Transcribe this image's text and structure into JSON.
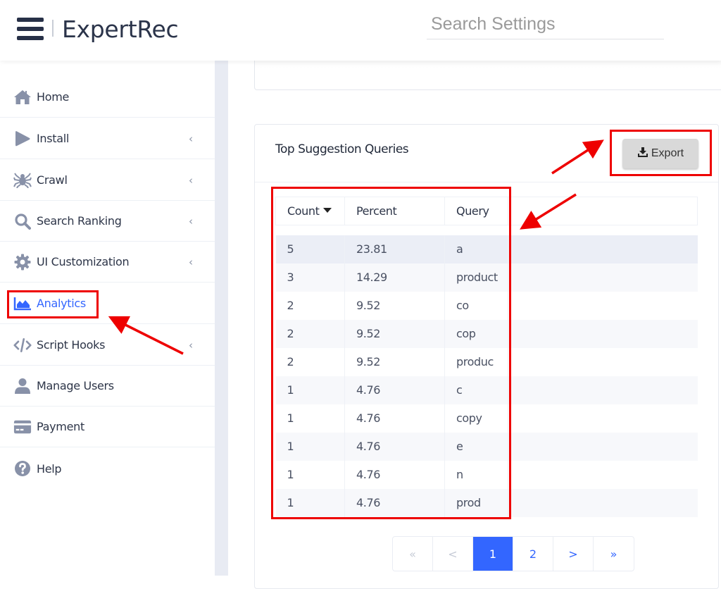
{
  "header": {
    "brand": "ExpertRec",
    "search_placeholder": "Search Settings"
  },
  "sidebar": {
    "items": [
      {
        "label": "Home",
        "icon": "home-icon",
        "has_chevron": false
      },
      {
        "label": "Install",
        "icon": "play-icon",
        "has_chevron": true
      },
      {
        "label": "Crawl",
        "icon": "spider-icon",
        "has_chevron": true
      },
      {
        "label": "Search Ranking",
        "icon": "search-icon",
        "has_chevron": true
      },
      {
        "label": "UI Customization",
        "icon": "gear-icon",
        "has_chevron": true
      },
      {
        "label": "Analytics",
        "icon": "area-chart-icon",
        "has_chevron": false,
        "active": true
      },
      {
        "label": "Script Hooks",
        "icon": "code-icon",
        "has_chevron": true
      },
      {
        "label": "Manage Users",
        "icon": "user-icon",
        "has_chevron": false
      },
      {
        "label": "Payment",
        "icon": "credit-card-icon",
        "has_chevron": false
      },
      {
        "label": "Help",
        "icon": "question-circle-icon",
        "has_chevron": false
      }
    ],
    "chevron": "‹"
  },
  "card": {
    "title": "Top Suggestion Queries",
    "export_label": "Export",
    "table": {
      "columns": [
        "Count",
        "Percent",
        "Query"
      ],
      "sorted_column": "Count",
      "sort_direction": "desc",
      "rows": [
        {
          "count": "5",
          "percent": "23.81",
          "query": "a"
        },
        {
          "count": "3",
          "percent": "14.29",
          "query": "product"
        },
        {
          "count": "2",
          "percent": "9.52",
          "query": "co"
        },
        {
          "count": "2",
          "percent": "9.52",
          "query": "cop"
        },
        {
          "count": "2",
          "percent": "9.52",
          "query": "produc"
        },
        {
          "count": "1",
          "percent": "4.76",
          "query": "c"
        },
        {
          "count": "1",
          "percent": "4.76",
          "query": "copy"
        },
        {
          "count": "1",
          "percent": "4.76",
          "query": "e"
        },
        {
          "count": "1",
          "percent": "4.76",
          "query": "n"
        },
        {
          "count": "1",
          "percent": "4.76",
          "query": "prod"
        }
      ]
    },
    "pagination": {
      "first": "«",
      "prev": "<",
      "pages": [
        "1",
        "2"
      ],
      "current_page": "1",
      "next": ">",
      "last": "»"
    }
  },
  "colors": {
    "accent": "#3366ff",
    "annotation": "#ee0000",
    "sidebar_icon": "#8891a8",
    "text": "#2d3548"
  }
}
